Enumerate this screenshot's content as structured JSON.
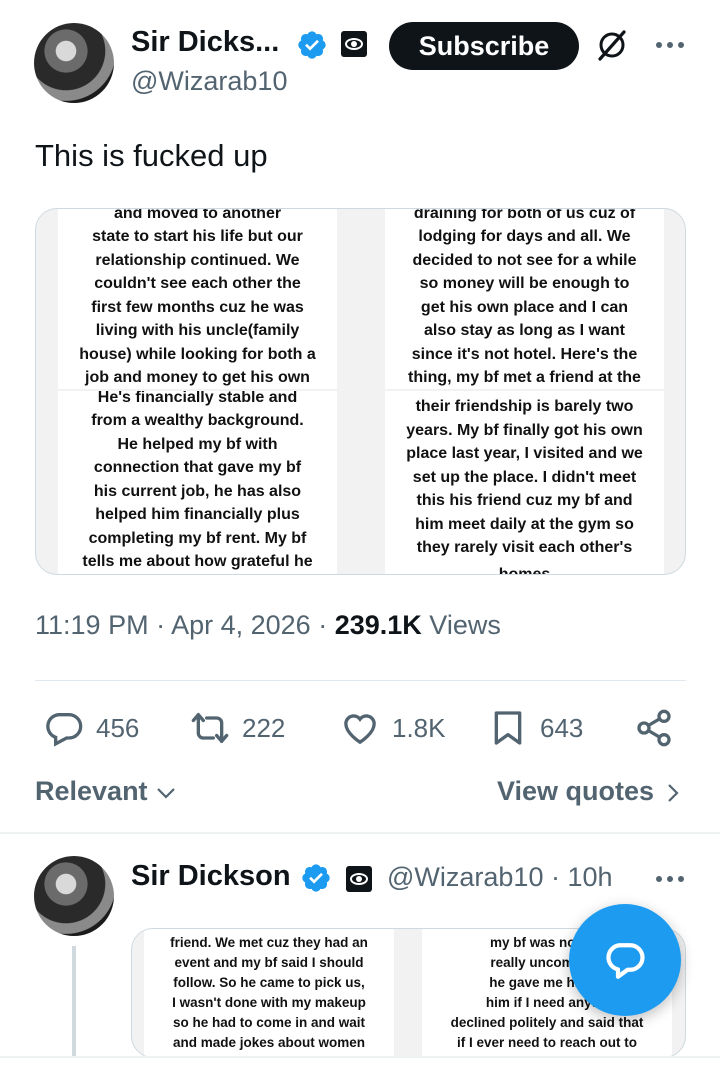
{
  "author": {
    "name": "Sir Dicks...",
    "handle": "@Wizarab10",
    "subscribe_label": "Subscribe"
  },
  "tweet": {
    "text": "This is fucked up",
    "time": "11:19 PM",
    "date": "Apr 4, 2026",
    "views_count": "239.1K",
    "views_label": "Views"
  },
  "media": {
    "top_left": [
      "and moved to another",
      "state to start his life but our",
      "relationship continued. We",
      "couldn't see each other the",
      "first few months cuz he was",
      "living with his uncle(family",
      "house) while looking for both a",
      "job and money to get his own"
    ],
    "bottom_left": [
      "He's financially stable and",
      "from a wealthy background.",
      "He helped my bf with",
      "connection that gave my bf",
      "his current job, he has also",
      "helped him financially plus",
      "completing my bf rent. My bf",
      "tells me about how grateful he"
    ],
    "top_right": [
      "draining for both of us cuz of",
      "lodging for days and all. We",
      "decided to not see for a while",
      "so money will be enough to",
      "get his own place and I can",
      "also stay as long as I want",
      "since it's not hotel. Here's the",
      "thing, my bf met a friend at the"
    ],
    "bottom_right": [
      "their friendship is barely two",
      "years. My bf finally got his own",
      "place last year, I visited and we",
      "set up the place. I didn't meet",
      "this his friend cuz my bf and",
      "him meet daily at the gym so",
      "they rarely visit each other's",
      "homes"
    ]
  },
  "actions": {
    "replies": "456",
    "reposts": "222",
    "likes": "1.8K",
    "bookmarks": "643"
  },
  "filters": {
    "sort_label": "Relevant",
    "quotes_label": "View quotes"
  },
  "reply": {
    "name": "Sir Dickson",
    "handle_time": "@Wizarab10 · 10h",
    "media_left": [
      "friend. We met cuz they had an",
      "event and my bf said I should",
      "follow. So he came to pick us,",
      "I wasn't done with my makeup",
      "so he had to come in and wait",
      "and made jokes about women"
    ],
    "media_right": [
      "my bf was not loo",
      "really uncomforta",
      "he gave me his ca",
      "him if I need anythi",
      "declined politely and said  that",
      "if I ever need to reach out to"
    ]
  },
  "colors": {
    "accent": "#1d9bf0",
    "text": "#0f1419",
    "muted": "#536471"
  }
}
